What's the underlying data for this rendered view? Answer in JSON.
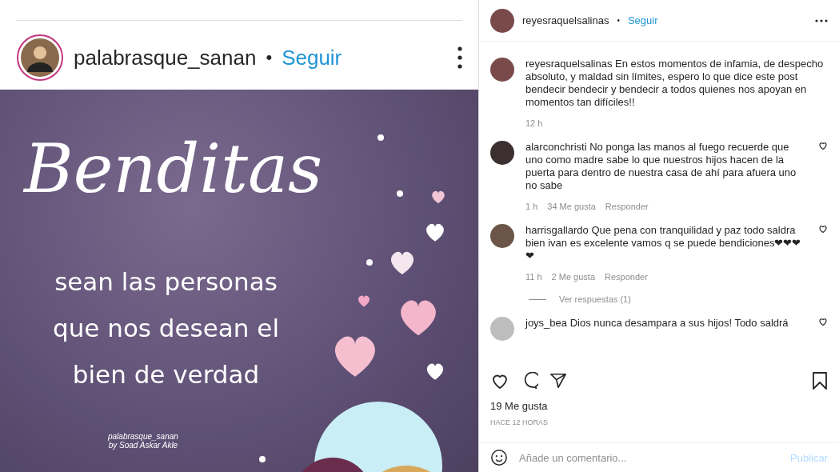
{
  "post_image": {
    "header": {
      "username": "palabrasque_sanan",
      "separator": "•",
      "follow": "Seguir"
    },
    "title": "Benditas",
    "lines": [
      "sean las personas",
      "que nos desean el",
      "bien de verdad"
    ],
    "credit": [
      "palabrasque_sanan",
      "by Soad Askar Akle"
    ]
  },
  "sidebar": {
    "header": {
      "username": "reyesraquelsalinas",
      "separator": "•",
      "follow": "Seguir"
    },
    "caption": {
      "username": "reyesraquelsalinas",
      "text": "En estos momentos de infamia, de despecho absoluto, y maldad sin límites, espero lo que dice este post bendecir bendecir y bendecir a todos quienes nos apoyan en momentos tan difíciles!!",
      "time": "12 h"
    },
    "comments": [
      {
        "username": "alarconchristi",
        "text": "No ponga las manos al fuego recuerde que uno como madre sabe lo que nuestros hijos hacen de la puerta para dentro de nuestra casa de ahí para afuera uno no sabe",
        "time": "1 h",
        "likes": "34 Me gusta",
        "reply": "Responder"
      },
      {
        "username": "harrisgallardo",
        "text": "Que pena con tranquilidad y paz todo saldra bien ivan es excelente vamos q se puede bendiciones❤❤❤❤",
        "time": "11 h",
        "likes": "2 Me gusta",
        "reply": "Responder",
        "replies": "Ver respuestas (1)"
      },
      {
        "username": "joys_bea",
        "text": "Dios nunca desampara a sus hijos! Todo saldrá"
      }
    ],
    "likes": "19 Me gusta",
    "date": "HACE 12 HORAS",
    "comment_input": {
      "placeholder": "Añade un comentario...",
      "submit": "Publicar"
    }
  }
}
